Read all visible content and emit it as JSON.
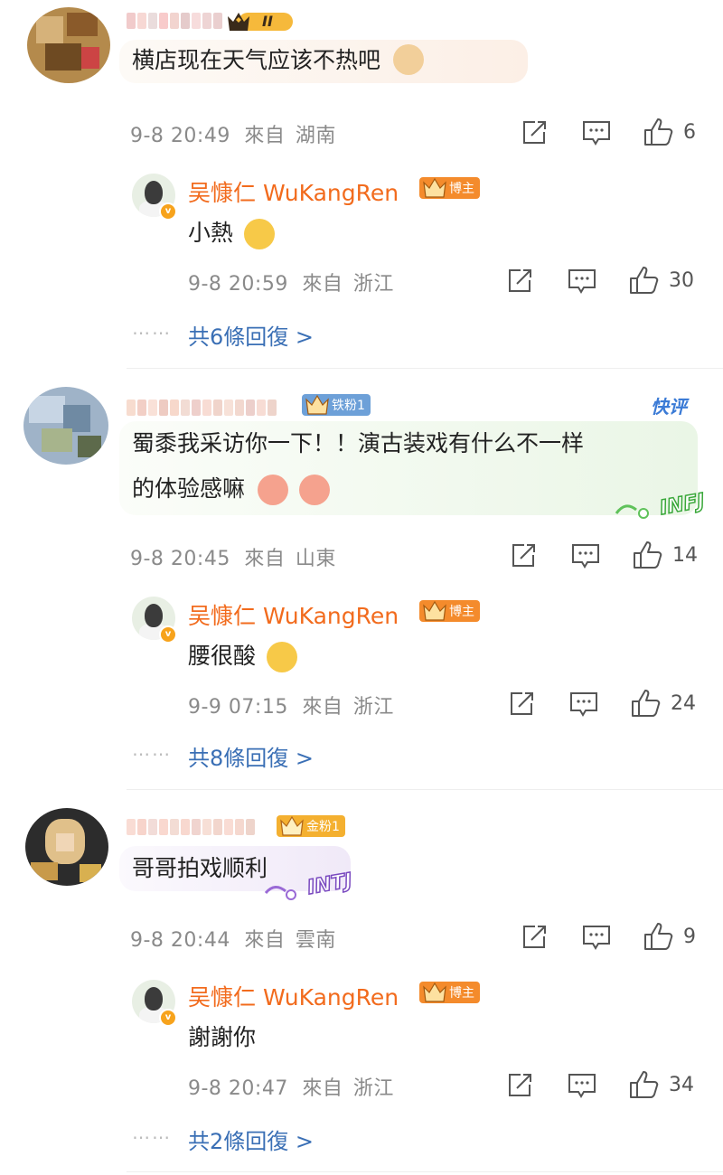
{
  "comments": [
    {
      "text": "横店现在天气应该不热吧",
      "level_badge": "II",
      "date": "9-8 20:49",
      "from": "來自",
      "location": "湖南",
      "likes": "6",
      "reply": {
        "name": "吴慷仁 WuKangRen",
        "badge": "博主",
        "text": "小熱",
        "date": "9-8 20:59",
        "from": "來自",
        "location": "浙江",
        "likes": "30"
      },
      "more": "共6條回復 >"
    },
    {
      "fan_badge": "铁粉1",
      "tag": "快评",
      "text_line1": "蜀黍我采访你一下！！演古装戏有什么不一样",
      "text_line2": "的体验感嘛",
      "sticker": "INFJ",
      "date": "9-8 20:45",
      "from": "來自",
      "location": "山東",
      "likes": "14",
      "reply": {
        "name": "吴慷仁 WuKangRen",
        "badge": "博主",
        "text": "腰很酸",
        "date": "9-9 07:15",
        "from": "來自",
        "location": "浙江",
        "likes": "24"
      },
      "more": "共8條回復 >"
    },
    {
      "fan_badge": "金粉1",
      "text": "哥哥拍戏顺利",
      "sticker": "INTJ",
      "date": "9-8 20:44",
      "from": "來自",
      "location": "雲南",
      "likes": "9",
      "reply": {
        "name": "吴慷仁 WuKangRen",
        "badge": "博主",
        "text": "謝謝你",
        "date": "9-8 20:47",
        "from": "來自",
        "location": "浙江",
        "likes": "34"
      },
      "more": "共2條回復 >"
    }
  ],
  "dots": "⋯⋯",
  "colors": {
    "accent_orange": "#f26b1d",
    "link_blue": "#3a6fb5",
    "meta_gray": "#8a8a8a"
  }
}
